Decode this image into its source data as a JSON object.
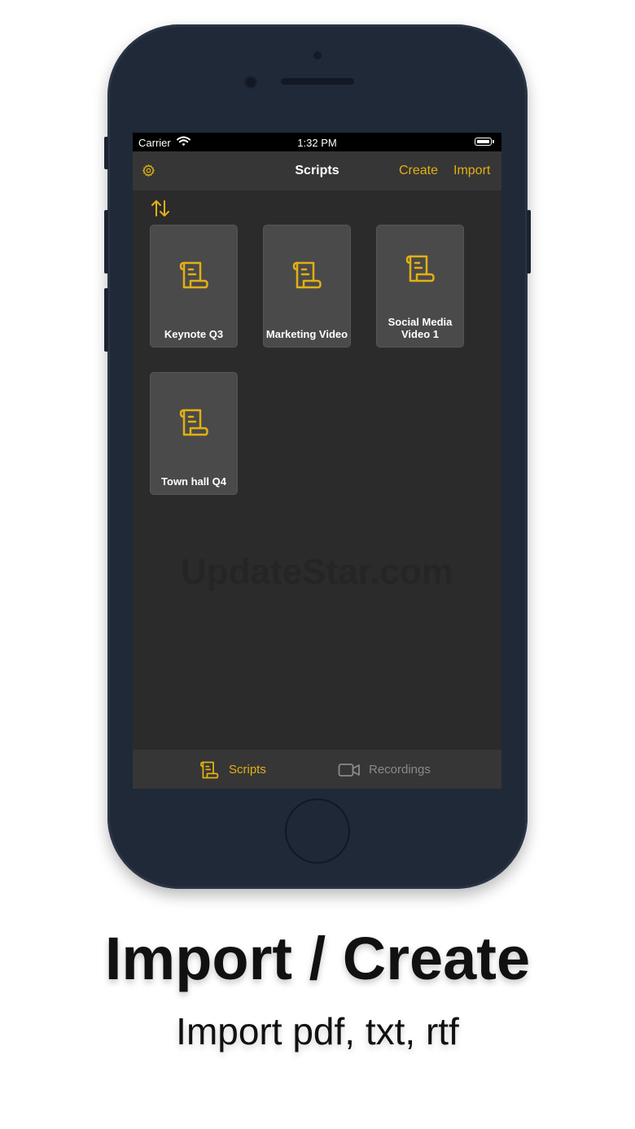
{
  "status_bar": {
    "carrier": "Carrier",
    "time": "1:32 PM"
  },
  "nav": {
    "title": "Scripts",
    "create_label": "Create",
    "import_label": "Import"
  },
  "scripts": [
    {
      "title": "Keynote Q3"
    },
    {
      "title": "Marketing Video"
    },
    {
      "title": "Social Media\nVideo 1"
    },
    {
      "title": "Town hall Q4"
    }
  ],
  "watermark": "UpdateStar.com",
  "tab_bar": {
    "tabs": [
      {
        "label": "Scripts",
        "icon": "scroll-icon",
        "active": true
      },
      {
        "label": "Recordings",
        "icon": "video-camera-icon",
        "active": false
      }
    ]
  },
  "promo": {
    "headline": "Import / Create",
    "subline": "Import pdf, txt, rtf"
  },
  "colors": {
    "accent": "#e2b013",
    "phone_body": "#202938",
    "screen_bg": "#2b2b2b",
    "card_bg": "#4a4a4a",
    "inactive": "#8a8a8a"
  }
}
